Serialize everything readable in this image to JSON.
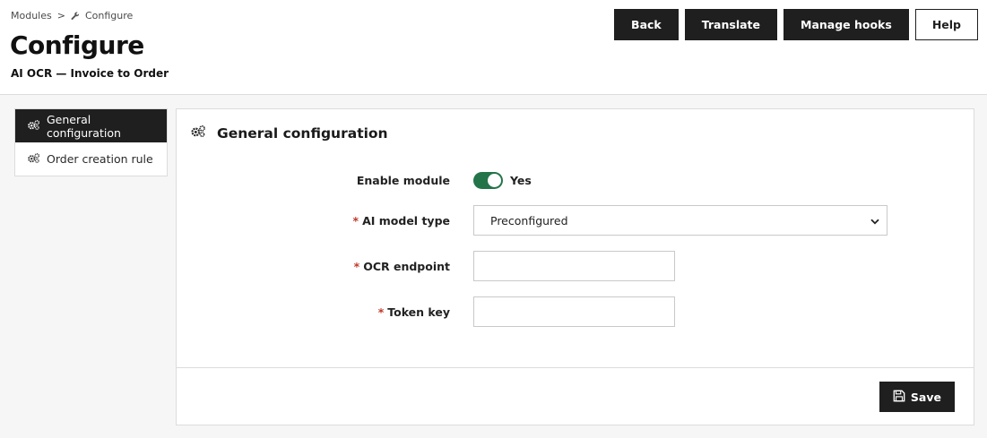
{
  "breadcrumb": {
    "parent": "Modules",
    "separator": ">",
    "current": "Configure"
  },
  "header": {
    "title": "Configure",
    "subtitle": "AI OCR — Invoice to Order"
  },
  "toolbar": {
    "back_label": "Back",
    "translate_label": "Translate",
    "manage_hooks_label": "Manage hooks",
    "help_label": "Help"
  },
  "sidebar": {
    "items": [
      {
        "label": "General configuration",
        "icon": "cogs-icon",
        "active": true
      },
      {
        "label": "Order creation rule",
        "icon": "cogs-icon",
        "active": false
      }
    ]
  },
  "panel": {
    "title": "General configuration",
    "icon": "cogs-icon"
  },
  "form": {
    "enable_module": {
      "label": "Enable module",
      "value": "Yes",
      "enabled": true
    },
    "ai_model_type": {
      "label": "AI model type",
      "required": "*",
      "value": "Preconfigured"
    },
    "ocr_endpoint": {
      "label": "OCR endpoint",
      "required": "*",
      "value": ""
    },
    "token_key": {
      "label": "Token key",
      "required": "*",
      "value": ""
    }
  },
  "footer": {
    "save_label": "Save"
  },
  "colors": {
    "primary_dark": "#1f1f1f",
    "toggle_on": "#24744a",
    "required": "#c0392b"
  }
}
